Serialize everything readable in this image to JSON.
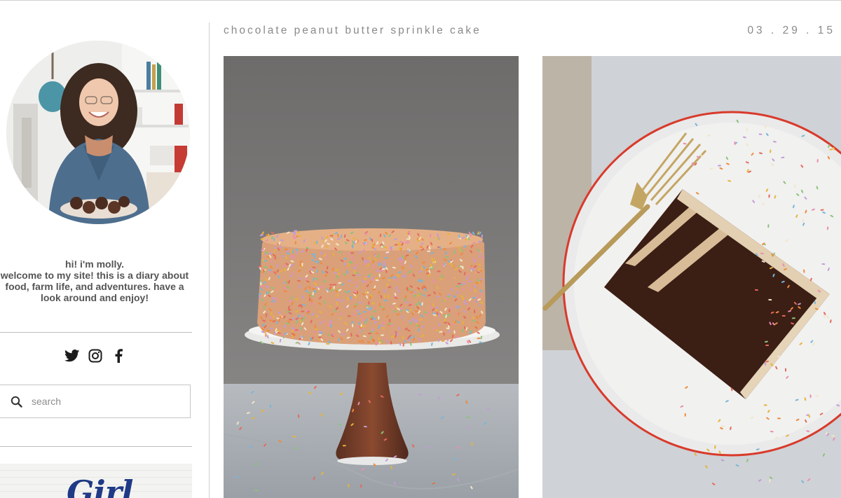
{
  "sidebar": {
    "bio": {
      "line1": "hi! i'm molly.",
      "line2": "welcome to my site! this is a diary about",
      "line3": "food, farm life, and adventures. have a",
      "line4": "look around and enjoy!"
    },
    "social": [
      "twitter-icon",
      "instagram-icon",
      "facebook-icon"
    ],
    "search": {
      "placeholder": "search",
      "value": ""
    },
    "promo": {
      "text": "Girl"
    }
  },
  "post": {
    "title": "chocolate peanut butter sprinkle cake",
    "date": "03 . 29 . 15"
  },
  "colors": {
    "text": "#555555",
    "meta": "#8a8a8a",
    "rule": "#cfcfcf",
    "plate_rim": "#d93a2b",
    "promo_ink": "#1f3a86"
  }
}
